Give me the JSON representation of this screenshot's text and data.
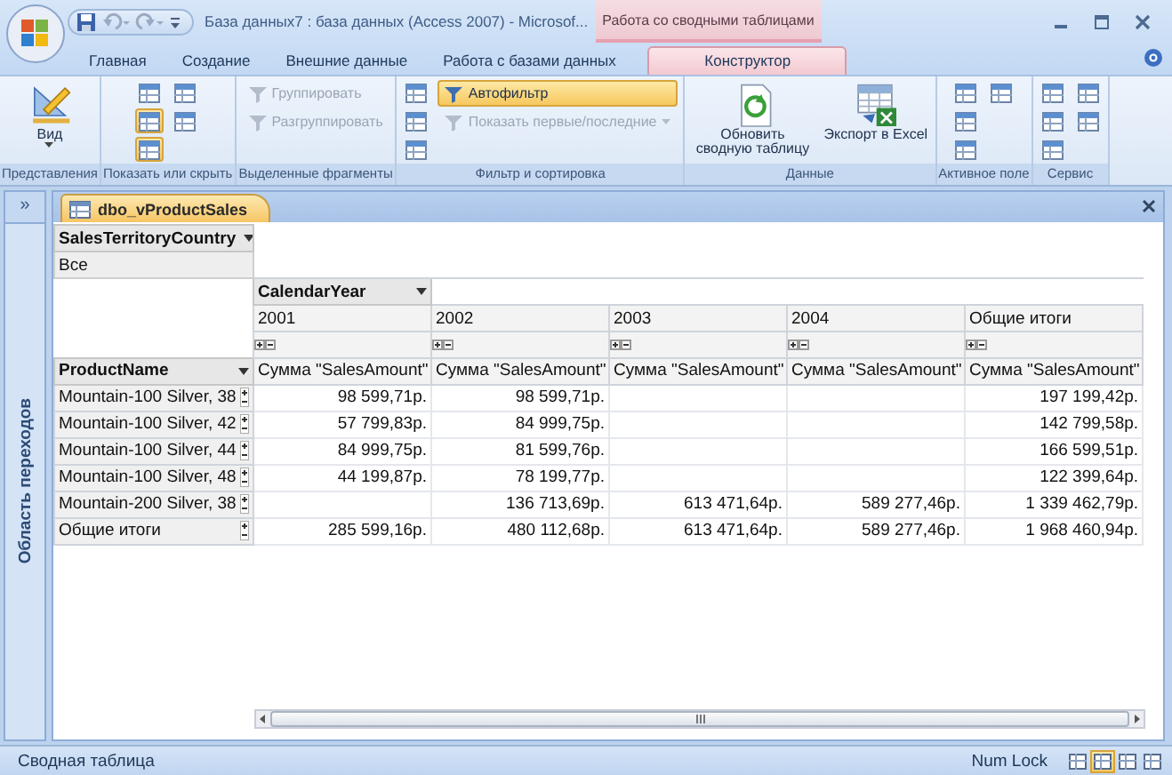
{
  "window": {
    "title": "База данных7 : база данных (Access 2007) - Microsof..."
  },
  "contextual_tab_group": "Работа со сводными таблицами",
  "ribbon_tabs": [
    {
      "label": "Главная",
      "selected": false
    },
    {
      "label": "Создание",
      "selected": false
    },
    {
      "label": "Внешние данные",
      "selected": false
    },
    {
      "label": "Работа с базами данных",
      "selected": false
    },
    {
      "label": "Конструктор",
      "selected": true
    }
  ],
  "ribbon_groups": [
    {
      "label": "Представления",
      "commands": [
        {
          "kind": "large",
          "label": "Вид",
          "dropdown": true
        }
      ]
    },
    {
      "label": "Показать или скрыть",
      "commands": [
        {
          "kind": "icon",
          "pressed": false
        },
        {
          "kind": "icon",
          "pressed": true
        },
        {
          "kind": "icon",
          "pressed": true
        },
        {
          "kind": "icon",
          "pressed": false
        },
        {
          "kind": "icon",
          "pressed": false
        }
      ]
    },
    {
      "label": "Выделенные фрагменты",
      "commands": [
        {
          "kind": "small",
          "label": "Группировать",
          "disabled": true
        },
        {
          "kind": "small",
          "label": "Разгруппировать",
          "disabled": true
        }
      ]
    },
    {
      "label": "Фильтр и сортировка",
      "commands": [
        {
          "kind": "icon",
          "pressed": false
        },
        {
          "kind": "icon",
          "pressed": false
        },
        {
          "kind": "icon",
          "pressed": false
        },
        {
          "kind": "small",
          "label": "Автофильтр",
          "pressed": true,
          "disabled": false
        },
        {
          "kind": "small",
          "label": "Показать первые/последние",
          "disabled": true,
          "dropdown": true
        }
      ]
    },
    {
      "label": "Данные",
      "commands": [
        {
          "kind": "large",
          "label": "Обновить сводную таблицу"
        },
        {
          "kind": "large",
          "label": "Экспорт в Excel"
        }
      ]
    },
    {
      "label": "Активное поле",
      "commands": [
        {
          "kind": "icon",
          "pressed": false
        },
        {
          "kind": "icon",
          "pressed": false
        },
        {
          "kind": "icon",
          "pressed": false
        },
        {
          "kind": "icon",
          "pressed": false
        }
      ]
    },
    {
      "label": "Сервис",
      "commands": [
        {
          "kind": "icon",
          "pressed": false
        },
        {
          "kind": "icon",
          "pressed": false
        },
        {
          "kind": "icon",
          "pressed": false
        },
        {
          "kind": "icon",
          "pressed": false
        },
        {
          "kind": "icon",
          "pressed": false
        }
      ]
    }
  ],
  "navigation_pane": {
    "toggle": "»",
    "title": "Область переходов"
  },
  "document_tab": {
    "label": "dbo_vProductSales"
  },
  "pivot": {
    "filter_field": "SalesTerritoryCountry",
    "filter_value": "Все",
    "column_field": "CalendarYear",
    "row_field": "ProductName",
    "columns": [
      {
        "label": "2001",
        "measure": "Сумма \"SalesAmount\""
      },
      {
        "label": "2002",
        "measure": "Сумма \"SalesAmount\""
      },
      {
        "label": "2003",
        "measure": "Сумма \"SalesAmount\""
      },
      {
        "label": "2004",
        "measure": "Сумма \"SalesAmount\""
      },
      {
        "label": "Общие итоги",
        "measure": "Сумма \"SalesAmount\""
      }
    ],
    "rows": [
      {
        "label": "Mountain-100 Silver, 38",
        "values": {
          "column_1": "98 599,71р.",
          "column_2": "98 599,71р.",
          "column_5": "197 199,42р."
        }
      },
      {
        "label": "Mountain-100 Silver, 42",
        "values": {
          "column_1": "57 799,83р.",
          "column_2": "84 999,75р.",
          "column_5": "142 799,58р."
        }
      },
      {
        "label": "Mountain-100 Silver, 44",
        "values": {
          "column_1": "84 999,75р.",
          "column_2": "81 599,76р.",
          "column_5": "166 599,51р."
        }
      },
      {
        "label": "Mountain-100 Silver, 48",
        "values": {
          "column_1": "44 199,87р.",
          "column_2": "78 199,77р.",
          "column_5": "122 399,64р."
        }
      },
      {
        "label": "Mountain-200 Silver, 38",
        "values": {
          "column_2": "136 713,69р.",
          "column_3": "613 471,64р.",
          "column_4": "589 277,46р.",
          "column_5": "1 339 462,79р."
        }
      },
      {
        "label": "Общие итоги",
        "values": {
          "column_1": "285 599,16р.",
          "column_2": "480 112,68р.",
          "column_3": "613 471,64р.",
          "column_4": "589 277,46р.",
          "column_5": "1 968 460,94р."
        }
      }
    ]
  },
  "status_bar": {
    "text": "Сводная таблица",
    "indicator": "Num Lock",
    "view_buttons": [
      {
        "selected": false
      },
      {
        "selected": true
      },
      {
        "selected": false
      },
      {
        "selected": false
      }
    ]
  }
}
